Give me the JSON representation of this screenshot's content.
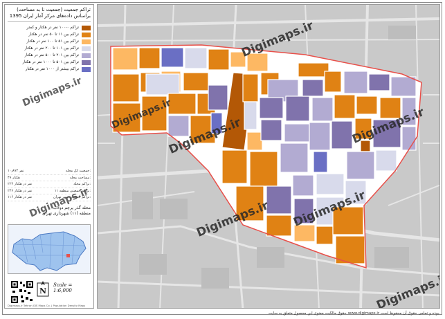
{
  "title": {
    "line1": "تراکم جمعیت (جمعیت نا به مساحت)",
    "line2": "براساس داده‌های مرکز آمار ایران 1395"
  },
  "legend": [
    {
      "label": "تراکم ۰-۱۰۰ نفر در هکتار و کمتر",
      "color": "#b35806"
    },
    {
      "label": "تراکم بین ۱۱ تا ۵۰ نفر در هکتار",
      "color": "#e08214"
    },
    {
      "label": "تراکم بین ۵۱ تا ۱۰۰ نفر در هکتار",
      "color": "#fdb863"
    },
    {
      "label": "تراکم بین ۱۰۱ تا ۲۰۰ نفر در هکتار",
      "color": "#d8daeb"
    },
    {
      "label": "تراکم بین ۲۰۱ تا ۵۰۰ نفر در هکتار",
      "color": "#b2abd2"
    },
    {
      "label": "تراکم بین ۵۰۱ تا ۱۰۰۰ نفر در هکتار",
      "color": "#8073ac"
    },
    {
      "label": "تراکم بیشتر از ۱۰۰۰ نفر در هکتار",
      "color": "#6a6fc4"
    }
  ],
  "stats": [
    {
      "label": "جمعیت کل محله:",
      "value": "۱۰٫۸۹۳ نفر"
    },
    {
      "label": "مساحت محله:",
      "value": "۴۹ هکتار"
    },
    {
      "label": "تراکم محله:",
      "value": "۲۲۳ نفر در هکتار"
    },
    {
      "label": "تراکم جمعیتی منطقه ۱۱:",
      "value": "۲۳۶ نفر در هکتار"
    },
    {
      "label": "تراکم جمعیتی شهر تهران:",
      "value": "۱۱۶ نفر در هکتار"
    }
  ],
  "district": {
    "line1": "محله گذر پرچم دولاب",
    "line2": "منطقه (۱۱) شهرداری تهران"
  },
  "scale": "Scale = 1:6,000",
  "north": "N",
  "credit": "Digimaps.ir Tehran GIS Maps Co. | Population Density Maps",
  "footer": "حقوق مالکیت معنوی این محصول متعلق به سایت www.digimaps.ir بوده و تمامی حقوق آن محفوظ است.",
  "watermark": "Digimaps.ir",
  "colors": {
    "dark_brown": "#b35806",
    "orange": "#e08214",
    "light_orange": "#fdb863",
    "lavender": "#d8daeb",
    "light_purple": "#b2abd2",
    "purple": "#8073ac",
    "blue_purple": "#6a6fc4",
    "boundary": "#e8504a"
  }
}
